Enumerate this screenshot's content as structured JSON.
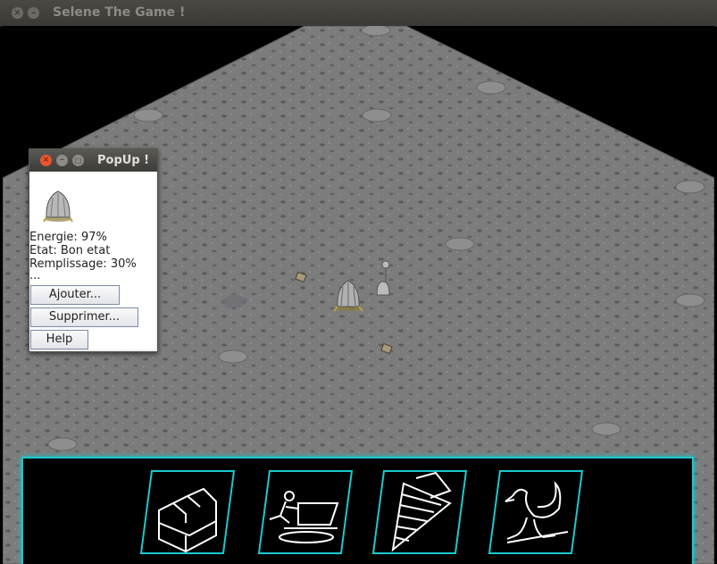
{
  "window": {
    "title": "Selene The Game !"
  },
  "popup": {
    "title": "PopUp !",
    "energie": "Energie: 97%",
    "etat": "Etat: Bon etat",
    "remplissage": "Remplissage: 30%",
    "ellipsis": "...",
    "buttons": {
      "ajouter": "Ajouter...",
      "supprimer": "Supprimer...",
      "help": "Help"
    }
  },
  "toolbar": {
    "tools": [
      {
        "icon": "factory-icon"
      },
      {
        "icon": "worker-cart-icon"
      },
      {
        "icon": "stairs-icon"
      },
      {
        "icon": "bird-icon"
      }
    ],
    "accent": "#19c9cf"
  },
  "colors": {
    "ground": "#7a7a7a",
    "background": "#000000"
  }
}
